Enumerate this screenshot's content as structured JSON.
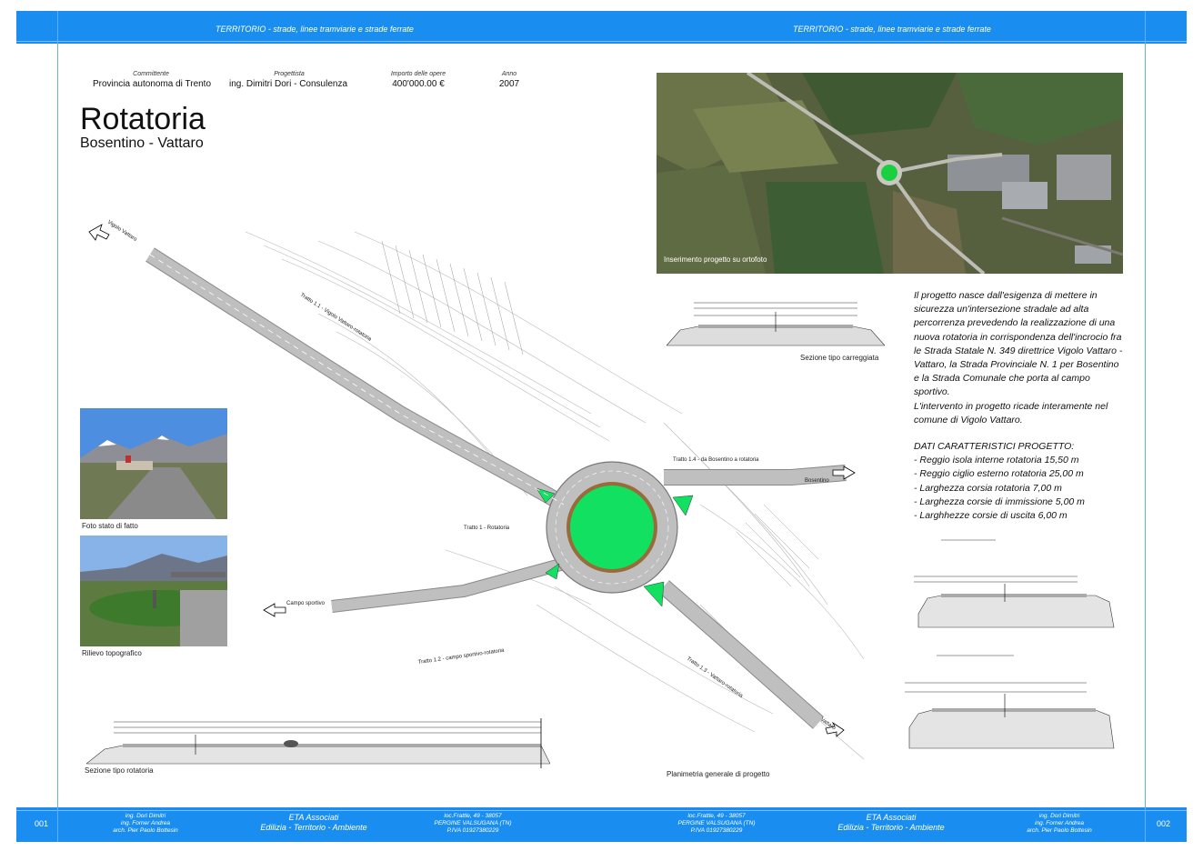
{
  "header": {
    "left": "TERRITORIO - strade, linee tramviarie e strade ferrate",
    "right": "TERRITORIO - strade, linee tramviarie e strade ferrate"
  },
  "meta": {
    "committente_label": "Committente",
    "committente_value": "Provincia autonoma di Trento",
    "progettista_label": "Progettista",
    "progettista_value": "ing. Dimitri Dori - Consulenza",
    "importo_label": "Importo delle opere",
    "importo_value": "400'000.00 €",
    "anno_label": "Anno",
    "anno_value": "2007"
  },
  "title": "Rotatoria",
  "subtitle": "Bosentino - Vattaro",
  "captions": {
    "ortofoto": "Inserimento progetto su ortofoto",
    "foto_stato": "Foto stato di fatto",
    "rilievo": "Rilievo topografico",
    "sezione_carreggiata": "Sezione tipo carreggiata",
    "sezione_rotatoria": "Sezione tipo rotatoria",
    "planimetria": "Planimetria generale di progetto"
  },
  "plan_labels": {
    "vigolo": "Vigolo Vattaro",
    "bosentino": "Bosentino",
    "campo": "Campo sportivo",
    "tratto11": "Tratto 1.1 - Vigolo Vattaro-rotatoria",
    "tratto14": "Tratto 1.4 - da Bosentino a rotatoria",
    "tratto1": "Tratto 1 - Rotatoria",
    "tratto12": "Tratto 1.2 - campo sportivo-rotatoria",
    "tratto13": "Tratto 1.3 - Vattaro-rotatoria",
    "vattaro": "Vattaro"
  },
  "description": [
    "Il progetto nasce dall'esigenza di mettere in sicurezza un'intersezione stradale ad alta percorrenza prevedendo la realizzazione di una nuova rotatoria in corrispondenza dell'incrocio fra le Strada Statale N. 349 direttrice Vigolo Vattaro - Vattaro, la Strada Provinciale N. 1 per Bosentino e la Strada Comunale che porta al campo sportivo.",
    "L'intervento in progetto ricade interamente nel comune di Vigolo Vattaro."
  ],
  "specs": {
    "title": "DATI CARATTERISTICI PROGETTO:",
    "items": [
      "- Reggio isola interne rotatoria 15,50 m",
      "- Reggio ciglio esterno rotatoria 25,00 m",
      "- Larghezza corsia rotatoria 7,00 m",
      "- Larghezza corsie di immissione 5,00 m",
      "- Larghhezze corsie di uscita 6,00 m"
    ]
  },
  "footer": {
    "page_left": "001",
    "page_right": "002",
    "authors": [
      "ing. Dori Dimitri",
      "ing. Forner Andrea",
      "arch. Pier Paolo Bottesin"
    ],
    "company": [
      "ETA Associati",
      "Edilizia - Territorio - Ambiente"
    ],
    "address": [
      "loc.Frattle, 49 - 38057",
      "PERGINE VALSUGANA (TN)",
      "P.IVA 01927380229"
    ]
  }
}
